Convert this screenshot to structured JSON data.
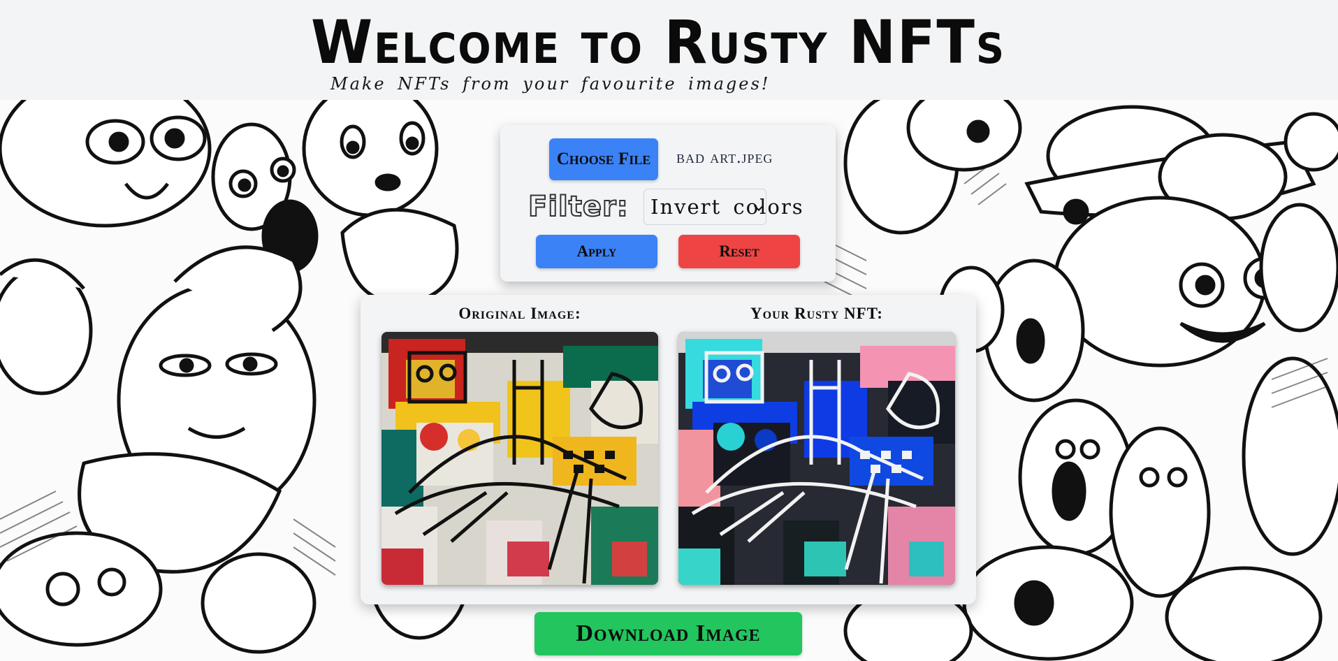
{
  "header": {
    "title": "Welcome to Rusty NFTs",
    "subtitle": "Make NFTs from your favourite images!"
  },
  "controls": {
    "choose_file_label": "Choose File",
    "file_name": "bad art.jpeg",
    "filter_label": "Filter:",
    "filter_selected": "Invert colors",
    "apply_label": "Apply",
    "reset_label": "Reset"
  },
  "images": {
    "original_label": "Original Image:",
    "result_label": "Your Rusty NFT:"
  },
  "download_label": "Download Image",
  "colors": {
    "blue_button": "#3b82f6",
    "red_button": "#ef4444",
    "green_button": "#22c55e",
    "panel": "#f3f4f6"
  },
  "icons": {
    "select_chevron": "chevron-down-icon"
  }
}
